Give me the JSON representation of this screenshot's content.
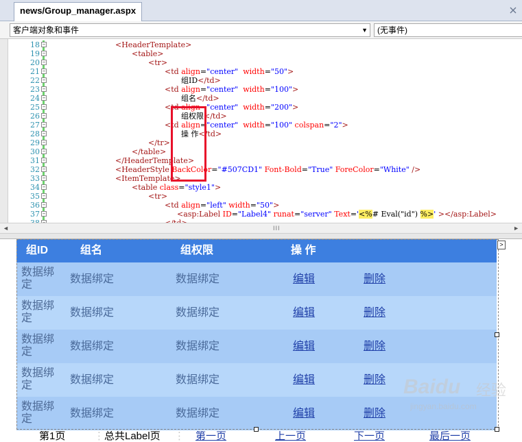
{
  "tab": {
    "title": "news/Group_manager.aspx"
  },
  "dropdowns": {
    "left": "客户端对象和事件",
    "right": "(无事件)"
  },
  "code_lines": [
    {
      "n": "18",
      "parts": [
        [
          "tg",
          "<HeaderTemplate>"
        ]
      ]
    },
    {
      "n": "19",
      "parts": [
        [
          "tg",
          "<table>"
        ]
      ]
    },
    {
      "n": "20",
      "parts": [
        [
          "tg",
          "<tr>"
        ]
      ]
    },
    {
      "n": "21",
      "parts": [
        [
          "tg",
          "<td "
        ],
        [
          "at",
          "align"
        ],
        [
          "tx",
          "="
        ],
        [
          "vl",
          "\"center\""
        ],
        [
          "tx",
          "  "
        ],
        [
          "at",
          "width"
        ],
        [
          "tx",
          "="
        ],
        [
          "vl",
          "\"50\""
        ],
        [
          "tg",
          ">"
        ]
      ]
    },
    {
      "n": "22",
      "parts": [
        [
          "tx",
          "组ID"
        ],
        [
          "tg",
          "</td>"
        ]
      ]
    },
    {
      "n": "23",
      "parts": [
        [
          "tg",
          "<td "
        ],
        [
          "at",
          "align"
        ],
        [
          "tx",
          "="
        ],
        [
          "vl",
          "\"center\""
        ],
        [
          "tx",
          "  "
        ],
        [
          "at",
          "width"
        ],
        [
          "tx",
          "="
        ],
        [
          "vl",
          "\"100\""
        ],
        [
          "tg",
          ">"
        ]
      ]
    },
    {
      "n": "24",
      "parts": [
        [
          "tx",
          "组名"
        ],
        [
          "tg",
          "</td>"
        ]
      ]
    },
    {
      "n": "25",
      "parts": [
        [
          "tg",
          "<td "
        ],
        [
          "at",
          "align"
        ],
        [
          "tx",
          "="
        ],
        [
          "vl",
          "\"center\""
        ],
        [
          "tx",
          "  "
        ],
        [
          "at",
          "width"
        ],
        [
          "tx",
          "="
        ],
        [
          "vl",
          "\"200\""
        ],
        [
          "tg",
          ">"
        ]
      ]
    },
    {
      "n": "26",
      "parts": [
        [
          "tx",
          "组权限"
        ],
        [
          "tg",
          "</td>"
        ]
      ]
    },
    {
      "n": "27",
      "parts": [
        [
          "tg",
          "<td "
        ],
        [
          "at",
          "align"
        ],
        [
          "tx",
          "="
        ],
        [
          "vl",
          "\"center\""
        ],
        [
          "tx",
          "  "
        ],
        [
          "at",
          "width"
        ],
        [
          "tx",
          "="
        ],
        [
          "vl",
          "\"100\""
        ],
        [
          "tx",
          " "
        ],
        [
          "at",
          "colspan"
        ],
        [
          "tx",
          "="
        ],
        [
          "vl",
          "\"2\""
        ],
        [
          "tg",
          ">"
        ]
      ]
    },
    {
      "n": "28",
      "parts": [
        [
          "tx",
          "操 作"
        ],
        [
          "tg",
          "</td>"
        ]
      ]
    },
    {
      "n": "29",
      "parts": [
        [
          "tg",
          "</tr>"
        ]
      ]
    },
    {
      "n": "30",
      "parts": [
        [
          "tg",
          "</table>"
        ]
      ]
    },
    {
      "n": "31",
      "parts": [
        [
          "tg",
          "</HeaderTemplate>"
        ]
      ]
    },
    {
      "n": "32",
      "parts": [
        [
          "tg",
          "<HeaderStyle "
        ],
        [
          "at",
          "BackColor"
        ],
        [
          "tx",
          "="
        ],
        [
          "vl",
          "\"#507CD1\""
        ],
        [
          "tx",
          " "
        ],
        [
          "at",
          "Font-Bold"
        ],
        [
          "tx",
          "="
        ],
        [
          "vl",
          "\"True\""
        ],
        [
          "tx",
          " "
        ],
        [
          "at",
          "ForeColor"
        ],
        [
          "tx",
          "="
        ],
        [
          "vl",
          "\"White\""
        ],
        [
          "tg",
          " />"
        ]
      ]
    },
    {
      "n": "33",
      "parts": [
        [
          "tg",
          "<ItemTemplate>"
        ]
      ]
    },
    {
      "n": "34",
      "parts": [
        [
          "tg",
          "<table "
        ],
        [
          "at",
          "class"
        ],
        [
          "tx",
          "="
        ],
        [
          "vl",
          "\"style1\""
        ],
        [
          "tg",
          ">"
        ]
      ]
    },
    {
      "n": "35",
      "parts": [
        [
          "tg",
          "<tr>"
        ]
      ]
    },
    {
      "n": "36",
      "parts": [
        [
          "tg",
          "<td "
        ],
        [
          "at",
          "align"
        ],
        [
          "tx",
          "="
        ],
        [
          "vl",
          "\"left\""
        ],
        [
          "tx",
          " "
        ],
        [
          "at",
          "width"
        ],
        [
          "tx",
          "="
        ],
        [
          "vl",
          "\"50\""
        ],
        [
          "tg",
          ">"
        ]
      ]
    },
    {
      "n": "37",
      "parts": [
        [
          "tg",
          "<asp:Label "
        ],
        [
          "at",
          "ID"
        ],
        [
          "tx",
          "="
        ],
        [
          "vl",
          "\"Label4\""
        ],
        [
          "tx",
          " "
        ],
        [
          "at",
          "runat"
        ],
        [
          "tx",
          "="
        ],
        [
          "vl",
          "\"server\""
        ],
        [
          "tx",
          " "
        ],
        [
          "at",
          "Text"
        ],
        [
          "tx",
          "="
        ],
        [
          "vl",
          "'"
        ],
        [
          "hl",
          "<%"
        ],
        [
          "tx",
          "# Eval(\"id\") "
        ],
        [
          "hl",
          "%>"
        ],
        [
          "vl",
          "'"
        ],
        [
          "tx",
          " "
        ],
        [
          "tg",
          "></asp:Label>"
        ]
      ]
    },
    {
      "n": "38",
      "parts": [
        [
          "tg",
          "</td>"
        ]
      ]
    }
  ],
  "grid": {
    "headers": [
      "组ID",
      "组名",
      "组权限",
      "操 作"
    ],
    "rows": [
      {
        "id": "数据绑定",
        "name": "数据绑定",
        "perm": "数据绑定",
        "edit": "编辑",
        "del": "删除"
      },
      {
        "id": "数据绑定",
        "name": "数据绑定",
        "perm": "数据绑定",
        "edit": "编辑",
        "del": "删除"
      },
      {
        "id": "数据绑定",
        "name": "数据绑定",
        "perm": "数据绑定",
        "edit": "编辑",
        "del": "删除"
      },
      {
        "id": "数据绑定",
        "name": "数据绑定",
        "perm": "数据绑定",
        "edit": "编辑",
        "del": "删除"
      },
      {
        "id": "数据绑定",
        "name": "数据绑定",
        "perm": "数据绑定",
        "edit": "编辑",
        "del": "删除"
      }
    ]
  },
  "pager": {
    "page": "第1页",
    "total": "总共Label页",
    "first": "第一页",
    "prev": "上一页",
    "next": "下一页",
    "last": "最后一页"
  },
  "watermark": {
    "brand": "Baidu",
    "brand2": "经验",
    "url": "jingyan.baidu.com"
  },
  "icons": {
    "dropdown": "chevron-down-icon",
    "smarttag": "chevron-right-icon"
  },
  "colors": {
    "header_bg": "#3d7fe0",
    "row_odd": "#a7cbf6",
    "row_even": "#b7d7fa",
    "highlight_box": "#e8102a"
  }
}
